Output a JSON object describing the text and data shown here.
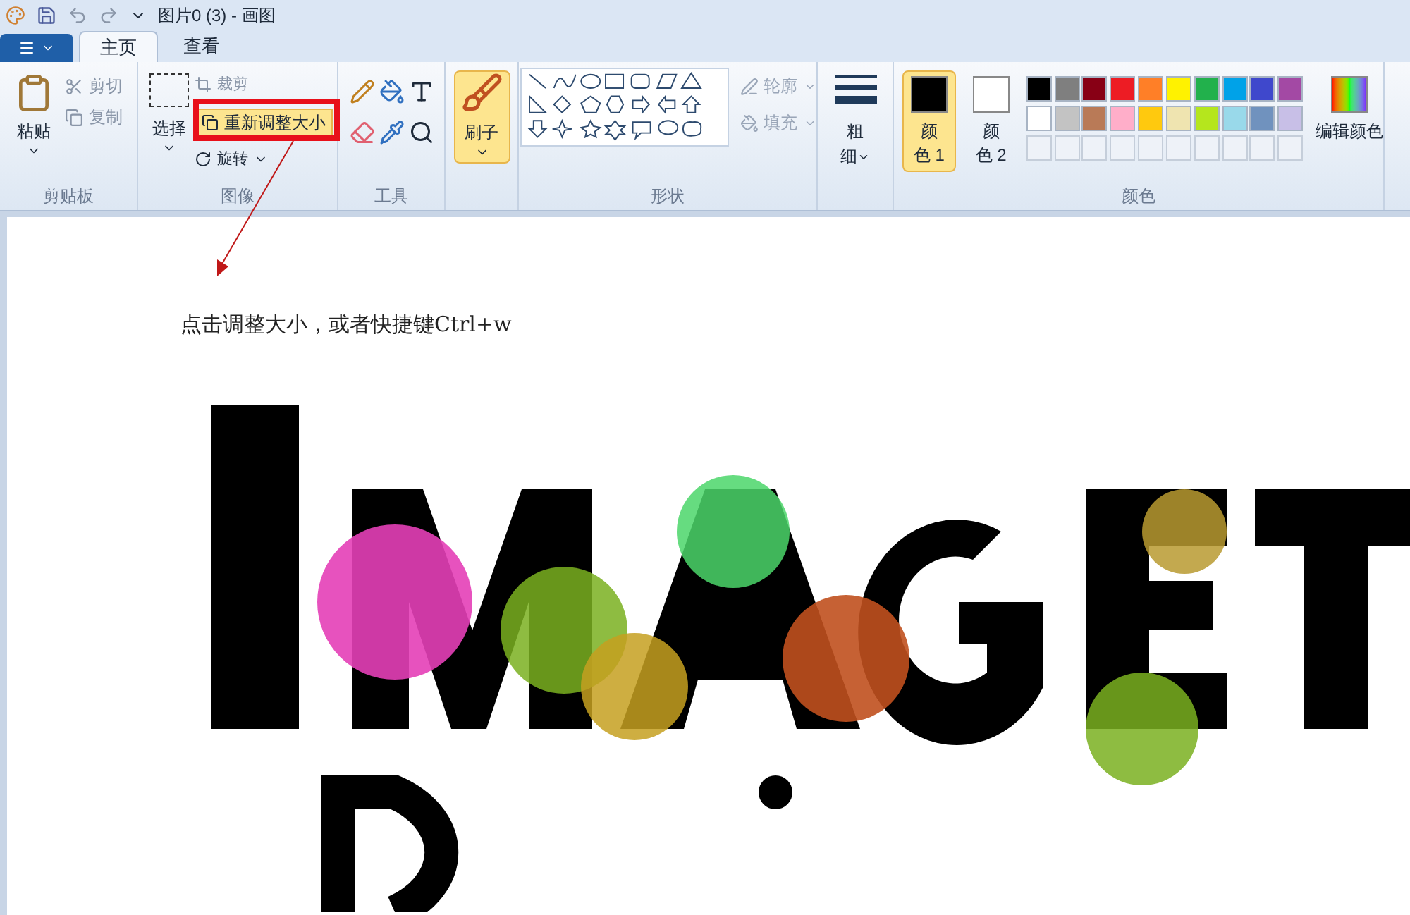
{
  "title_bar": {
    "title": "图片0 (3) - 画图"
  },
  "tabs": [
    {
      "label": "主页",
      "selected": true
    },
    {
      "label": "查看",
      "selected": false
    }
  ],
  "clipboard": {
    "paste": "粘贴",
    "cut": "剪切",
    "copy": "复制",
    "label": "剪贴板"
  },
  "image": {
    "select": "选择",
    "crop": "裁剪",
    "resize": "重新调整大小",
    "rotate": "旋转",
    "label": "图像"
  },
  "tools": {
    "label": "工具"
  },
  "brush": {
    "label": "刷子",
    "selected": true
  },
  "shapes": {
    "outline": "轮廓",
    "fill": "填充",
    "disabled": true,
    "label": "形状"
  },
  "size": {
    "lines": [
      "粗",
      "细"
    ]
  },
  "colors": {
    "color1": {
      "lines": [
        "颜",
        "色 1"
      ],
      "selected": true
    },
    "color2": {
      "lines": [
        "颜",
        "色 2"
      ],
      "selected": false
    },
    "swatches": [
      {
        "color": "#000000"
      },
      {
        "color": "#7f7f7f"
      },
      {
        "color": "#880015"
      },
      {
        "color": "#ed1c24"
      },
      {
        "color": "#ff7f27"
      },
      {
        "color": "#fff200"
      },
      {
        "color": "#22b14c"
      },
      {
        "color": "#00a2e8"
      },
      {
        "color": "#3f48cc"
      },
      {
        "color": "#a349a4"
      },
      {
        "color": "#ffffff"
      },
      {
        "color": "#c3c3c3"
      },
      {
        "color": "#b97a57"
      },
      {
        "color": "#ffaec9"
      },
      {
        "color": "#ffc90e"
      },
      {
        "color": "#efe4b0"
      },
      {
        "color": "#b5e61d"
      },
      {
        "color": "#99d9ea"
      },
      {
        "color": "#7092be"
      },
      {
        "color": "#c8bfe7"
      }
    ],
    "edit": "编辑颜色",
    "label": "颜色"
  },
  "annotation": {
    "text": "点击调整大小，或者快捷键Ctrl+w"
  }
}
